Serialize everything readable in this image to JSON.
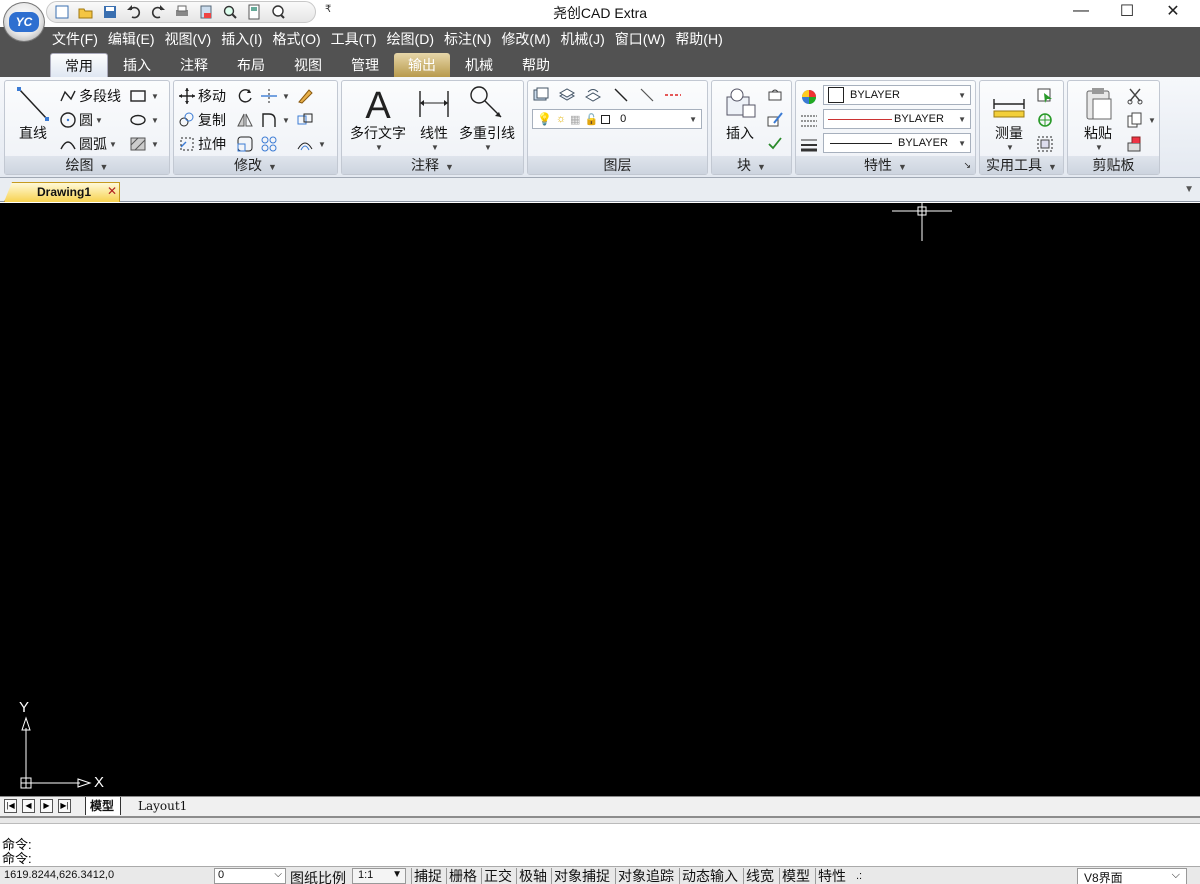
{
  "window": {
    "title": "尧创CAD Extra",
    "logo_text": "YC",
    "min": "—",
    "max": "☐",
    "close": "✕",
    "qat_more": "₹"
  },
  "menu": [
    "文件(F)",
    "编辑(E)",
    "视图(V)",
    "插入(I)",
    "格式(O)",
    "工具(T)",
    "绘图(D)",
    "标注(N)",
    "修改(M)",
    "机械(J)",
    "窗口(W)",
    "帮助(H)"
  ],
  "ribbon_tabs": [
    "常用",
    "插入",
    "注释",
    "布局",
    "视图",
    "管理",
    "输出",
    "机械",
    "帮助"
  ],
  "active_tab": "常用",
  "ribbon": {
    "draw": {
      "title": "绘图",
      "line": "直线",
      "polyline": "多段线",
      "circle": "圆",
      "arc": "圆弧"
    },
    "modify": {
      "title": "修改",
      "move": "移动",
      "copy": "复制",
      "stretch": "拉伸"
    },
    "annotation": {
      "title": "注释",
      "mtext": "多行文字",
      "linear": "线性",
      "mleader": "多重引线"
    },
    "layer": {
      "title": "图层",
      "current": "0"
    },
    "block": {
      "title": "块",
      "insert": "插入"
    },
    "properties": {
      "title": "特性",
      "color": "BYLAYER",
      "linetype": "BYLAYER",
      "lineweight": "BYLAYER"
    },
    "utilities": {
      "title": "实用工具",
      "measure": "测量"
    },
    "clipboard": {
      "title": "剪贴板",
      "paste": "粘贴"
    }
  },
  "document_tab": "Drawing1",
  "ucs": {
    "x_label": "X",
    "y_label": "Y"
  },
  "layout_tabs": [
    "模型",
    "Layout1"
  ],
  "command": {
    "line1": "命令:",
    "line2": "命令:"
  },
  "status": {
    "coords": "1619.8244,626.3412,0",
    "layer": "0",
    "scale_label": "图纸比例",
    "scale": "1:1",
    "toggles": [
      "捕捉",
      "栅格",
      "正交",
      "极轴",
      "对象捕捉",
      "对象追踪",
      "动态输入",
      "线宽",
      "模型",
      "特性"
    ],
    "extra": ".:",
    "ui_mode": "V8界面"
  }
}
